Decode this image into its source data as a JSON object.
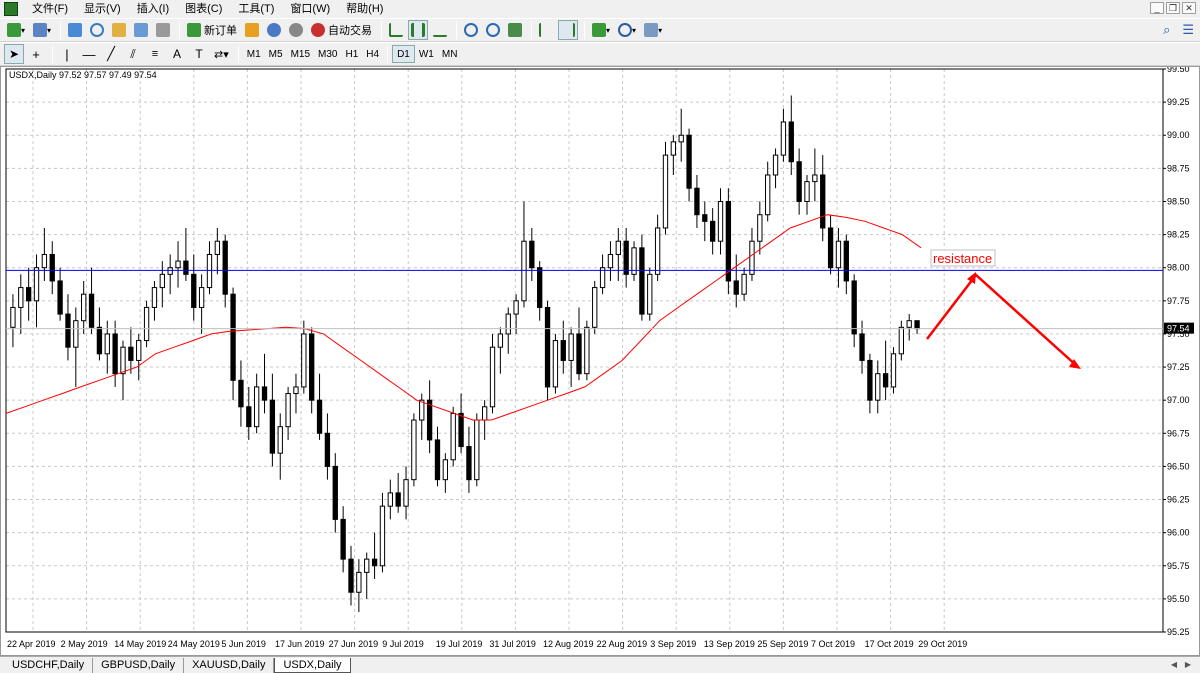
{
  "menu": {
    "items": [
      "文件(F)",
      "显示(V)",
      "插入(I)",
      "图表(C)",
      "工具(T)",
      "窗口(W)",
      "帮助(H)"
    ]
  },
  "toolbar": {
    "new_order_label": "新订单",
    "auto_trade_label": "自动交易",
    "timeframes": [
      "M1",
      "M5",
      "M15",
      "M30",
      "H1",
      "H4",
      "D1",
      "W1",
      "MN"
    ],
    "active_timeframe": "D1"
  },
  "chart": {
    "header": "USDX,Daily  97.52 97.57 97.49 97.54",
    "current_price_label": "97.54",
    "resistance_label": "resistance",
    "resistance_level": 97.98,
    "price_scale": [
      "99.50",
      "99.25",
      "99.00",
      "98.75",
      "98.50",
      "98.25",
      "98.00",
      "97.75",
      "97.50",
      "97.25",
      "97.00",
      "96.75",
      "96.50",
      "96.25",
      "96.00",
      "95.75",
      "95.50",
      "95.25"
    ],
    "date_labels": [
      "22 Apr 2019",
      "2 May 2019",
      "14 May 2019",
      "24 May 2019",
      "5 Jun 2019",
      "17 Jun 2019",
      "27 Jun 2019",
      "9 Jul 2019",
      "19 Jul 2019",
      "31 Jul 2019",
      "12 Aug 2019",
      "22 Aug 2019",
      "3 Sep 2019",
      "13 Sep 2019",
      "25 Sep 2019",
      "7 Oct 2019",
      "17 Oct 2019",
      "29 Oct 2019"
    ],
    "colors": {
      "ma_line": "#ff0000",
      "resistance_line": "#0000ff",
      "arrow": "#ff0000",
      "grid": "#c8c8c8"
    }
  },
  "chart_data": {
    "type": "candlestick",
    "symbol": "USDX",
    "timeframe": "Daily",
    "ylim": [
      95.25,
      99.5
    ],
    "ohlc": [
      [
        97.55,
        97.8,
        97.4,
        97.7
      ],
      [
        97.7,
        97.95,
        97.5,
        97.85
      ],
      [
        97.85,
        98.0,
        97.6,
        97.75
      ],
      [
        97.75,
        98.1,
        97.55,
        98.0
      ],
      [
        98.0,
        98.3,
        97.9,
        98.1
      ],
      [
        98.1,
        98.2,
        97.8,
        97.9
      ],
      [
        97.9,
        98.0,
        97.6,
        97.65
      ],
      [
        97.65,
        97.8,
        97.3,
        97.4
      ],
      [
        97.4,
        97.7,
        97.1,
        97.6
      ],
      [
        97.6,
        97.9,
        97.5,
        97.8
      ],
      [
        97.8,
        98.0,
        97.5,
        97.55
      ],
      [
        97.55,
        97.7,
        97.3,
        97.35
      ],
      [
        97.35,
        97.6,
        97.2,
        97.5
      ],
      [
        97.5,
        97.6,
        97.1,
        97.2
      ],
      [
        97.2,
        97.45,
        97.0,
        97.4
      ],
      [
        97.4,
        97.55,
        97.2,
        97.3
      ],
      [
        97.3,
        97.5,
        97.15,
        97.45
      ],
      [
        97.45,
        97.75,
        97.4,
        97.7
      ],
      [
        97.7,
        97.9,
        97.6,
        97.85
      ],
      [
        97.85,
        98.05,
        97.7,
        97.95
      ],
      [
        97.95,
        98.1,
        97.8,
        98.0
      ],
      [
        98.0,
        98.2,
        97.85,
        98.05
      ],
      [
        98.05,
        98.3,
        97.9,
        97.95
      ],
      [
        97.95,
        98.1,
        97.6,
        97.7
      ],
      [
        97.7,
        97.95,
        97.5,
        97.85
      ],
      [
        97.85,
        98.2,
        97.8,
        98.1
      ],
      [
        98.1,
        98.3,
        97.95,
        98.2
      ],
      [
        98.2,
        98.25,
        97.7,
        97.8
      ],
      [
        97.8,
        97.85,
        97.0,
        97.15
      ],
      [
        97.15,
        97.3,
        96.8,
        96.95
      ],
      [
        96.95,
        97.1,
        96.7,
        96.8
      ],
      [
        96.8,
        97.2,
        96.75,
        97.1
      ],
      [
        97.1,
        97.35,
        96.9,
        97.0
      ],
      [
        97.0,
        97.2,
        96.5,
        96.6
      ],
      [
        96.6,
        96.9,
        96.4,
        96.8
      ],
      [
        96.8,
        97.1,
        96.7,
        97.05
      ],
      [
        97.05,
        97.2,
        96.9,
        97.1
      ],
      [
        97.1,
        97.6,
        97.05,
        97.5
      ],
      [
        97.5,
        97.55,
        96.9,
        97.0
      ],
      [
        97.0,
        97.2,
        96.7,
        96.75
      ],
      [
        96.75,
        96.9,
        96.4,
        96.5
      ],
      [
        96.5,
        96.6,
        96.0,
        96.1
      ],
      [
        96.1,
        96.2,
        95.7,
        95.8
      ],
      [
        95.8,
        95.9,
        95.45,
        95.55
      ],
      [
        95.55,
        95.8,
        95.4,
        95.7
      ],
      [
        95.7,
        95.85,
        95.5,
        95.8
      ],
      [
        95.8,
        96.0,
        95.65,
        95.75
      ],
      [
        95.75,
        96.3,
        95.7,
        96.2
      ],
      [
        96.2,
        96.4,
        96.1,
        96.3
      ],
      [
        96.3,
        96.45,
        96.15,
        96.2
      ],
      [
        96.2,
        96.5,
        96.1,
        96.4
      ],
      [
        96.4,
        96.9,
        96.35,
        96.85
      ],
      [
        96.85,
        97.05,
        96.7,
        97.0
      ],
      [
        97.0,
        97.15,
        96.6,
        96.7
      ],
      [
        96.7,
        96.8,
        96.35,
        96.4
      ],
      [
        96.4,
        96.6,
        96.3,
        96.55
      ],
      [
        96.55,
        96.95,
        96.5,
        96.9
      ],
      [
        96.9,
        97.05,
        96.6,
        96.65
      ],
      [
        96.65,
        96.8,
        96.3,
        96.4
      ],
      [
        96.4,
        96.9,
        96.35,
        96.85
      ],
      [
        96.85,
        97.0,
        96.7,
        96.95
      ],
      [
        96.95,
        97.5,
        96.9,
        97.4
      ],
      [
        97.4,
        97.55,
        97.2,
        97.5
      ],
      [
        97.5,
        97.7,
        97.35,
        97.65
      ],
      [
        97.65,
        97.8,
        97.5,
        97.75
      ],
      [
        97.75,
        98.5,
        97.7,
        98.2
      ],
      [
        98.2,
        98.3,
        97.9,
        98.0
      ],
      [
        98.0,
        98.05,
        97.6,
        97.7
      ],
      [
        97.7,
        97.75,
        97.0,
        97.1
      ],
      [
        97.1,
        97.5,
        97.05,
        97.45
      ],
      [
        97.45,
        97.6,
        97.2,
        97.3
      ],
      [
        97.3,
        97.55,
        97.1,
        97.5
      ],
      [
        97.5,
        97.7,
        97.15,
        97.2
      ],
      [
        97.2,
        97.6,
        97.15,
        97.55
      ],
      [
        97.55,
        97.9,
        97.5,
        97.85
      ],
      [
        97.85,
        98.1,
        97.8,
        98.0
      ],
      [
        98.0,
        98.2,
        97.9,
        98.1
      ],
      [
        98.1,
        98.3,
        97.9,
        98.2
      ],
      [
        98.2,
        98.3,
        97.85,
        97.95
      ],
      [
        97.95,
        98.2,
        97.9,
        98.15
      ],
      [
        98.15,
        98.25,
        97.6,
        97.65
      ],
      [
        97.65,
        98.0,
        97.6,
        97.95
      ],
      [
        97.95,
        98.4,
        97.9,
        98.3
      ],
      [
        98.3,
        98.95,
        98.25,
        98.85
      ],
      [
        98.85,
        99.0,
        98.7,
        98.95
      ],
      [
        98.95,
        99.2,
        98.8,
        99.0
      ],
      [
        99.0,
        99.05,
        98.5,
        98.6
      ],
      [
        98.6,
        98.7,
        98.3,
        98.4
      ],
      [
        98.4,
        98.5,
        98.2,
        98.35
      ],
      [
        98.35,
        98.45,
        98.1,
        98.2
      ],
      [
        98.2,
        98.6,
        98.1,
        98.5
      ],
      [
        98.5,
        98.6,
        97.8,
        97.9
      ],
      [
        97.9,
        98.1,
        97.7,
        97.8
      ],
      [
        97.8,
        98.0,
        97.75,
        97.95
      ],
      [
        97.95,
        98.3,
        97.9,
        98.2
      ],
      [
        98.2,
        98.5,
        98.1,
        98.4
      ],
      [
        98.4,
        98.8,
        98.35,
        98.7
      ],
      [
        98.7,
        98.9,
        98.6,
        98.85
      ],
      [
        98.85,
        99.2,
        98.8,
        99.1
      ],
      [
        99.1,
        99.3,
        98.7,
        98.8
      ],
      [
        98.8,
        98.9,
        98.4,
        98.5
      ],
      [
        98.5,
        98.7,
        98.4,
        98.65
      ],
      [
        98.65,
        98.9,
        98.5,
        98.7
      ],
      [
        98.7,
        98.85,
        98.2,
        98.3
      ],
      [
        98.3,
        98.4,
        97.95,
        98.0
      ],
      [
        98.0,
        98.3,
        97.85,
        98.2
      ],
      [
        98.2,
        98.25,
        97.8,
        97.9
      ],
      [
        97.9,
        97.95,
        97.4,
        97.5
      ],
      [
        97.5,
        97.6,
        97.2,
        97.3
      ],
      [
        97.3,
        97.35,
        96.9,
        97.0
      ],
      [
        97.0,
        97.3,
        96.9,
        97.2
      ],
      [
        97.2,
        97.45,
        97.0,
        97.1
      ],
      [
        97.1,
        97.4,
        97.05,
        97.35
      ],
      [
        97.35,
        97.6,
        97.3,
        97.55
      ],
      [
        97.55,
        97.65,
        97.45,
        97.6
      ],
      [
        97.6,
        97.6,
        97.5,
        97.54
      ]
    ],
    "moving_average": [
      96.9,
      96.95,
      97.0,
      97.05,
      97.1,
      97.15,
      97.2,
      97.25,
      97.35,
      97.4,
      97.45,
      97.5,
      97.52,
      97.53,
      97.54,
      97.55,
      97.54,
      97.5,
      97.4,
      97.3,
      97.2,
      97.1,
      97.0,
      96.95,
      96.9,
      96.85,
      96.85,
      96.9,
      96.95,
      97.0,
      97.05,
      97.1,
      97.2,
      97.3,
      97.45,
      97.6,
      97.7,
      97.8,
      97.9,
      98.0,
      98.1,
      98.2,
      98.3,
      98.35,
      98.4,
      98.38,
      98.35,
      98.3,
      98.25,
      98.15
    ],
    "resistance_level": 97.98,
    "annotation": "resistance"
  }
}
